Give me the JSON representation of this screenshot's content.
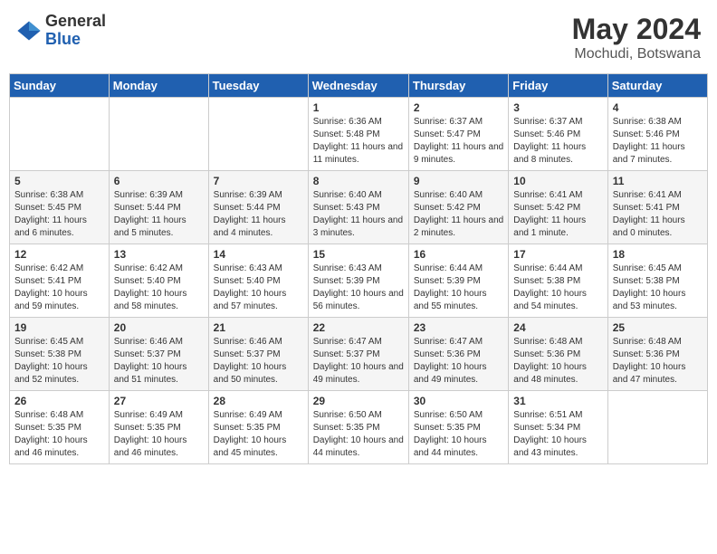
{
  "header": {
    "logo_general": "General",
    "logo_blue": "Blue",
    "main_title": "May 2024",
    "sub_title": "Mochudi, Botswana"
  },
  "days_of_week": [
    "Sunday",
    "Monday",
    "Tuesday",
    "Wednesday",
    "Thursday",
    "Friday",
    "Saturday"
  ],
  "weeks": [
    [
      {
        "day": "",
        "info": ""
      },
      {
        "day": "",
        "info": ""
      },
      {
        "day": "",
        "info": ""
      },
      {
        "day": "1",
        "info": "Sunrise: 6:36 AM\nSunset: 5:48 PM\nDaylight: 11 hours and 11 minutes."
      },
      {
        "day": "2",
        "info": "Sunrise: 6:37 AM\nSunset: 5:47 PM\nDaylight: 11 hours and 9 minutes."
      },
      {
        "day": "3",
        "info": "Sunrise: 6:37 AM\nSunset: 5:46 PM\nDaylight: 11 hours and 8 minutes."
      },
      {
        "day": "4",
        "info": "Sunrise: 6:38 AM\nSunset: 5:46 PM\nDaylight: 11 hours and 7 minutes."
      }
    ],
    [
      {
        "day": "5",
        "info": "Sunrise: 6:38 AM\nSunset: 5:45 PM\nDaylight: 11 hours and 6 minutes."
      },
      {
        "day": "6",
        "info": "Sunrise: 6:39 AM\nSunset: 5:44 PM\nDaylight: 11 hours and 5 minutes."
      },
      {
        "day": "7",
        "info": "Sunrise: 6:39 AM\nSunset: 5:44 PM\nDaylight: 11 hours and 4 minutes."
      },
      {
        "day": "8",
        "info": "Sunrise: 6:40 AM\nSunset: 5:43 PM\nDaylight: 11 hours and 3 minutes."
      },
      {
        "day": "9",
        "info": "Sunrise: 6:40 AM\nSunset: 5:42 PM\nDaylight: 11 hours and 2 minutes."
      },
      {
        "day": "10",
        "info": "Sunrise: 6:41 AM\nSunset: 5:42 PM\nDaylight: 11 hours and 1 minute."
      },
      {
        "day": "11",
        "info": "Sunrise: 6:41 AM\nSunset: 5:41 PM\nDaylight: 11 hours and 0 minutes."
      }
    ],
    [
      {
        "day": "12",
        "info": "Sunrise: 6:42 AM\nSunset: 5:41 PM\nDaylight: 10 hours and 59 minutes."
      },
      {
        "day": "13",
        "info": "Sunrise: 6:42 AM\nSunset: 5:40 PM\nDaylight: 10 hours and 58 minutes."
      },
      {
        "day": "14",
        "info": "Sunrise: 6:43 AM\nSunset: 5:40 PM\nDaylight: 10 hours and 57 minutes."
      },
      {
        "day": "15",
        "info": "Sunrise: 6:43 AM\nSunset: 5:39 PM\nDaylight: 10 hours and 56 minutes."
      },
      {
        "day": "16",
        "info": "Sunrise: 6:44 AM\nSunset: 5:39 PM\nDaylight: 10 hours and 55 minutes."
      },
      {
        "day": "17",
        "info": "Sunrise: 6:44 AM\nSunset: 5:38 PM\nDaylight: 10 hours and 54 minutes."
      },
      {
        "day": "18",
        "info": "Sunrise: 6:45 AM\nSunset: 5:38 PM\nDaylight: 10 hours and 53 minutes."
      }
    ],
    [
      {
        "day": "19",
        "info": "Sunrise: 6:45 AM\nSunset: 5:38 PM\nDaylight: 10 hours and 52 minutes."
      },
      {
        "day": "20",
        "info": "Sunrise: 6:46 AM\nSunset: 5:37 PM\nDaylight: 10 hours and 51 minutes."
      },
      {
        "day": "21",
        "info": "Sunrise: 6:46 AM\nSunset: 5:37 PM\nDaylight: 10 hours and 50 minutes."
      },
      {
        "day": "22",
        "info": "Sunrise: 6:47 AM\nSunset: 5:37 PM\nDaylight: 10 hours and 49 minutes."
      },
      {
        "day": "23",
        "info": "Sunrise: 6:47 AM\nSunset: 5:36 PM\nDaylight: 10 hours and 49 minutes."
      },
      {
        "day": "24",
        "info": "Sunrise: 6:48 AM\nSunset: 5:36 PM\nDaylight: 10 hours and 48 minutes."
      },
      {
        "day": "25",
        "info": "Sunrise: 6:48 AM\nSunset: 5:36 PM\nDaylight: 10 hours and 47 minutes."
      }
    ],
    [
      {
        "day": "26",
        "info": "Sunrise: 6:48 AM\nSunset: 5:35 PM\nDaylight: 10 hours and 46 minutes."
      },
      {
        "day": "27",
        "info": "Sunrise: 6:49 AM\nSunset: 5:35 PM\nDaylight: 10 hours and 46 minutes."
      },
      {
        "day": "28",
        "info": "Sunrise: 6:49 AM\nSunset: 5:35 PM\nDaylight: 10 hours and 45 minutes."
      },
      {
        "day": "29",
        "info": "Sunrise: 6:50 AM\nSunset: 5:35 PM\nDaylight: 10 hours and 44 minutes."
      },
      {
        "day": "30",
        "info": "Sunrise: 6:50 AM\nSunset: 5:35 PM\nDaylight: 10 hours and 44 minutes."
      },
      {
        "day": "31",
        "info": "Sunrise: 6:51 AM\nSunset: 5:34 PM\nDaylight: 10 hours and 43 minutes."
      },
      {
        "day": "",
        "info": ""
      }
    ]
  ]
}
